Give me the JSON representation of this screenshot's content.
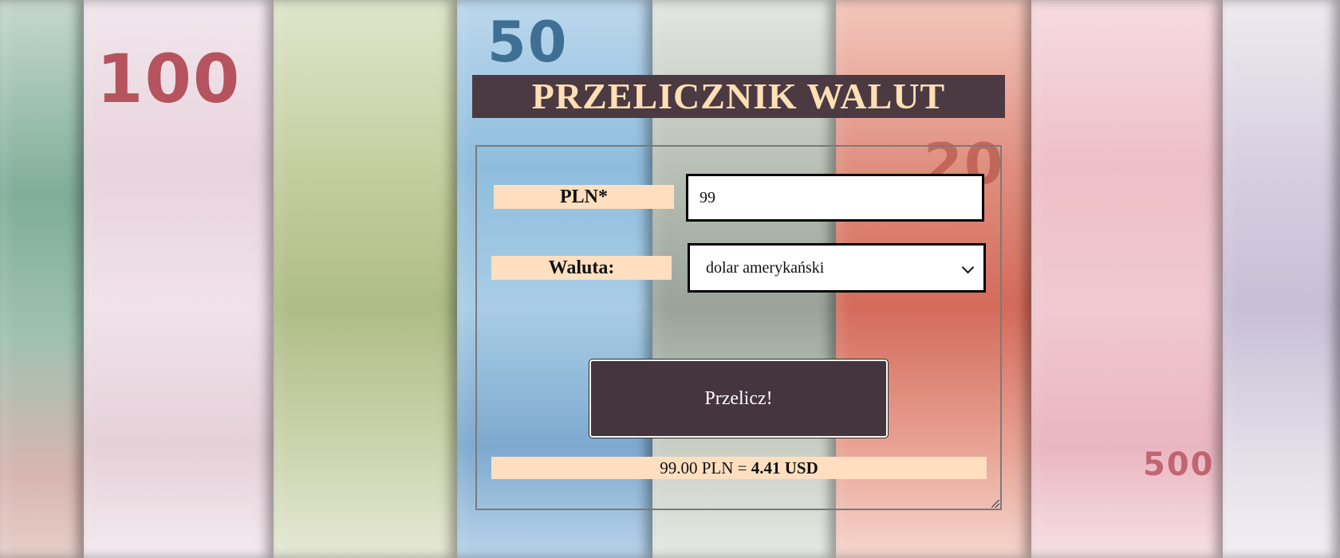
{
  "header": {
    "title": "PRZELICZNIK WALUT"
  },
  "form": {
    "amount_label": "PLN*",
    "amount_value": "99",
    "currency_label": "Waluta:",
    "currency_selected": "dolar amerykański",
    "convert_button_label": "Przelicz!"
  },
  "result": {
    "input_amount": "99.00 PLN",
    "equals": "=",
    "output_amount": "4.41 USD"
  },
  "background": {
    "banknote_numbers": [
      "100",
      "50",
      "20",
      "500"
    ]
  }
}
